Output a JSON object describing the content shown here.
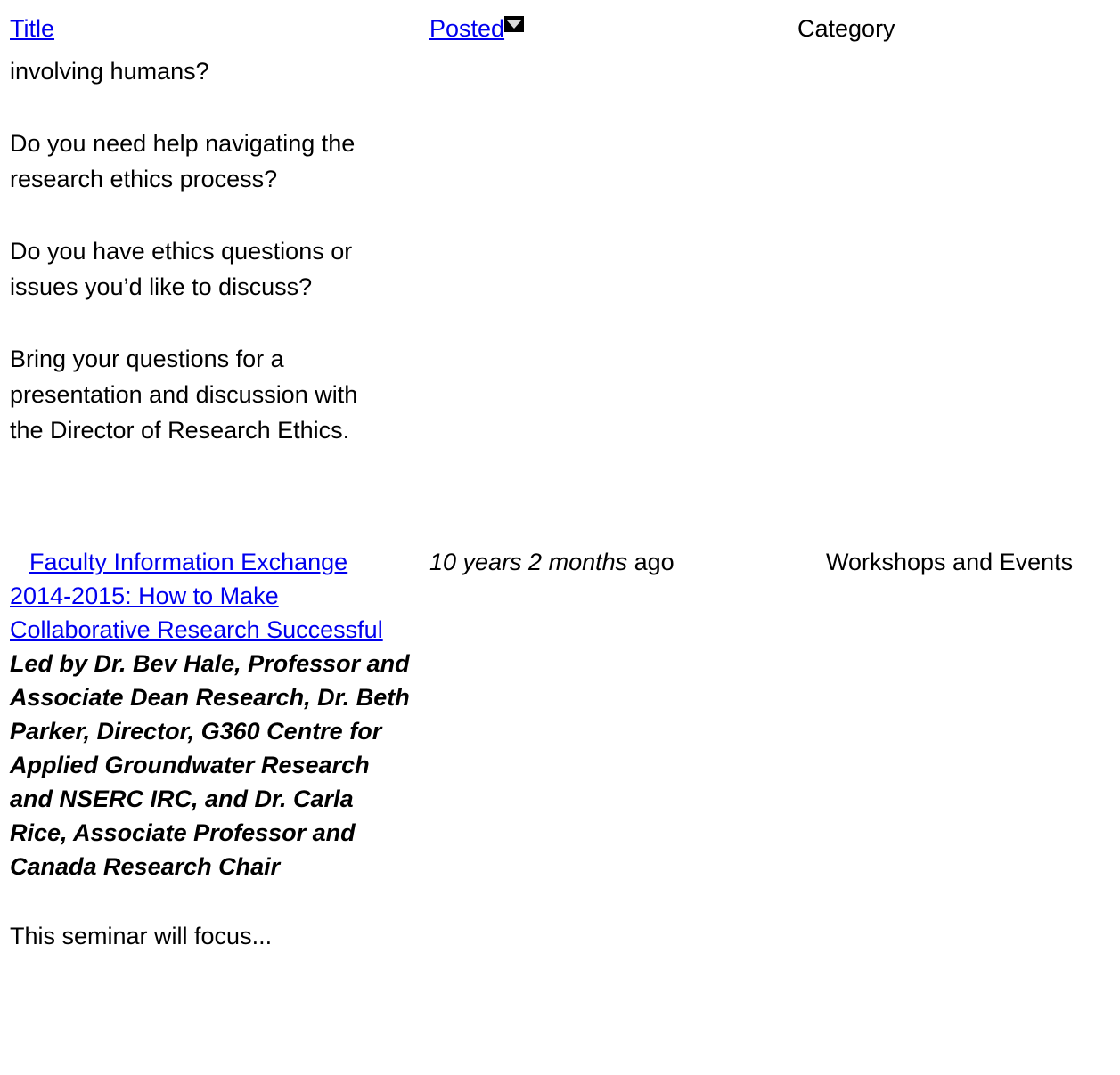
{
  "table": {
    "headers": {
      "title": "Title",
      "posted": "Posted",
      "category": "Category"
    },
    "sort_icon": "sort-descending-icon",
    "rows": [
      {
        "body_paragraphs": [
          "involving humans?",
          "Do you need help navigating the research ethics process?",
          "Do you have ethics questions or issues you’d like to discuss?",
          "Bring your questions for a presentation and discussion with the Director of Research Ethics."
        ]
      },
      {
        "title": "Faculty Information Exchange 2014-2015: How to Make Collaborative Research Successful",
        "lead": "Led by Dr. Bev Hale, Professor and Associate Dean Research, Dr. Beth Parker, Director, G360 Centre for Applied Groundwater Research and NSERC IRC, and Dr. Carla Rice, Associate Professor and Canada Research Chair",
        "teaser": "This seminar will focus...",
        "posted_italic": "10 years 2 months",
        "posted_suffix": " ago",
        "category": "Workshops and Events"
      }
    ]
  }
}
